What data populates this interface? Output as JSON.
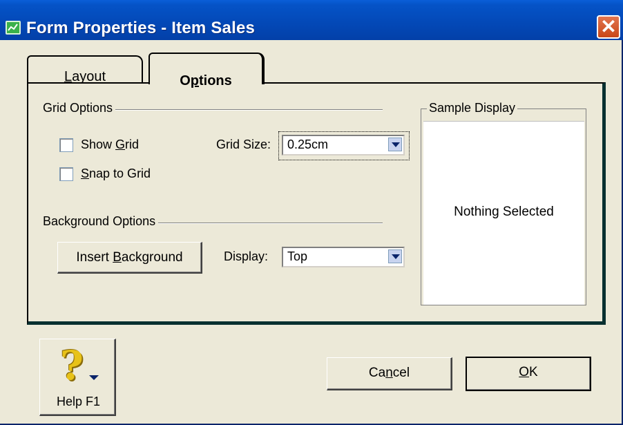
{
  "window": {
    "title": "Form Properties - Item Sales",
    "close_label": "✕"
  },
  "tabs": [
    {
      "label_pre": "",
      "label_key": "L",
      "label_post": "ayout",
      "active": false
    },
    {
      "label_pre": "O",
      "label_key": "p",
      "label_post": "tions",
      "active": true
    }
  ],
  "grid_options": {
    "group_label": "Grid Options",
    "show_grid": {
      "pre": "Show ",
      "key": "G",
      "post": "rid",
      "checked": false
    },
    "snap_to_grid": {
      "pre": "",
      "key": "S",
      "post": "nap to Grid",
      "checked": false
    },
    "grid_size_label": "Grid Size:",
    "grid_size_value": "0.25cm"
  },
  "background_options": {
    "group_label": "Background Options",
    "insert_pre": "Insert ",
    "insert_key": "B",
    "insert_post": "ackground",
    "display_label": "Display:",
    "display_value": "Top"
  },
  "sample_display": {
    "group_label": "Sample Display",
    "text": "Nothing Selected"
  },
  "footer": {
    "help_label": "Help F1",
    "cancel_pre": "Ca",
    "cancel_key": "n",
    "cancel_post": "cel",
    "ok_key": "O",
    "ok_post": "K"
  },
  "colors": {
    "titlebar": "#0348b6",
    "dialog_bg": "#ece9d8",
    "close_button": "#c94717"
  },
  "icons": [
    "app-chart-icon",
    "close-icon",
    "checkbox-icon",
    "dropdown-arrow-icon",
    "help-question-icon"
  ]
}
